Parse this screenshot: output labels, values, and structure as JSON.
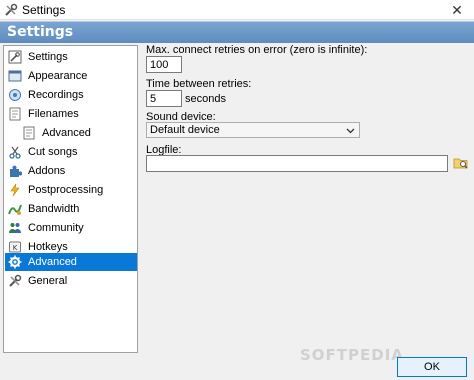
{
  "window": {
    "title": "Settings",
    "close_glyph": "✕",
    "app_icon": "tools-icon"
  },
  "header": {
    "title": "Settings",
    "color": "#6b96c8"
  },
  "sidebar": {
    "items": [
      {
        "label": "Settings",
        "icon": "settings-icon",
        "selected": false,
        "sub": false
      },
      {
        "label": "Appearance",
        "icon": "appearance-icon",
        "selected": false,
        "sub": false
      },
      {
        "label": "Recordings",
        "icon": "recordings-icon",
        "selected": false,
        "sub": false
      },
      {
        "label": "Filenames",
        "icon": "filenames-icon",
        "selected": false,
        "sub": false
      },
      {
        "label": "Advanced",
        "icon": "advanced-icon",
        "selected": false,
        "sub": true
      },
      {
        "label": "Cut songs",
        "icon": "cut-songs-icon",
        "selected": false,
        "sub": false
      },
      {
        "label": "Addons",
        "icon": "addons-icon",
        "selected": false,
        "sub": false
      },
      {
        "label": "Postprocessing",
        "icon": "postprocessing-icon",
        "selected": false,
        "sub": false
      },
      {
        "label": "Bandwidth",
        "icon": "bandwidth-icon",
        "selected": false,
        "sub": false
      },
      {
        "label": "Community",
        "icon": "community-icon",
        "selected": false,
        "sub": false
      },
      {
        "label": "Hotkeys",
        "icon": "hotkeys-icon",
        "selected": false,
        "sub": false
      },
      {
        "label": "Advanced",
        "icon": "advanced-gear-icon",
        "selected": true,
        "sub": false
      },
      {
        "label": "General",
        "icon": "general-icon",
        "selected": false,
        "sub": false
      }
    ],
    "selected_color": "#0a78d7"
  },
  "form": {
    "retries_label": "Max. connect retries on error (zero is infinite):",
    "retries_value": "100",
    "between_label": "Time between retries:",
    "between_value": "5",
    "between_unit": "seconds",
    "sound_label": "Sound device:",
    "sound_value": "Default device",
    "logfile_label": "Logfile:",
    "logfile_value": ""
  },
  "footer": {
    "ok_label": "OK",
    "watermark": "SOFTPEDIA"
  }
}
